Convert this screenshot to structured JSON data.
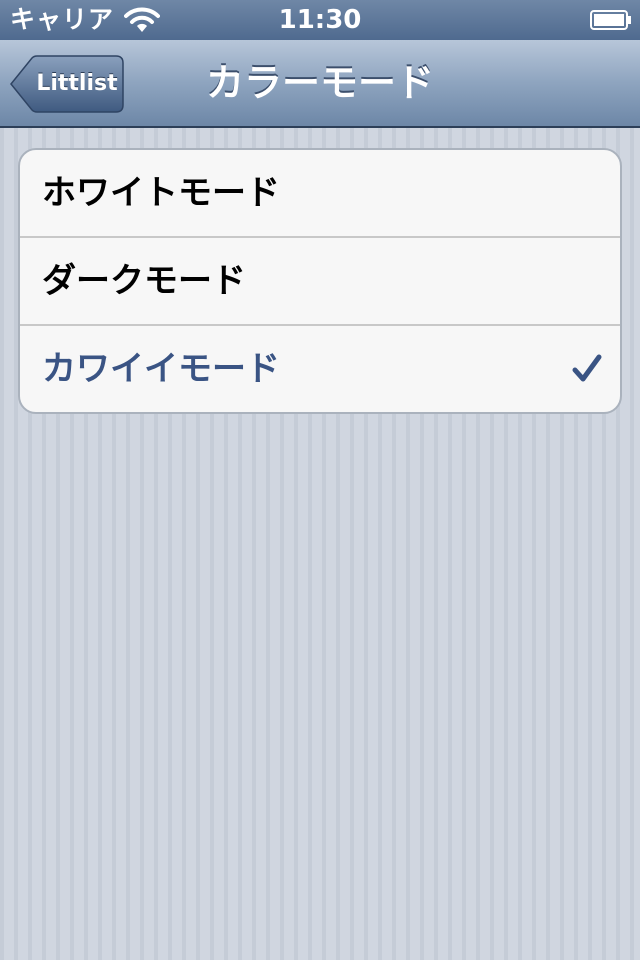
{
  "status_bar": {
    "carrier": "キャリア",
    "time": "11:30",
    "wifi_icon": "wifi-icon",
    "battery_icon": "battery-icon"
  },
  "nav": {
    "back_label": "Littlist",
    "title": "カラーモード"
  },
  "options": [
    {
      "label": "ホワイトモード",
      "selected": false
    },
    {
      "label": "ダークモード",
      "selected": false
    },
    {
      "label": "カワイイモード",
      "selected": true
    }
  ],
  "colors": {
    "selected_text": "#3a5484",
    "nav_bar": "#8ea4bf",
    "background": "#cbd2dc"
  }
}
